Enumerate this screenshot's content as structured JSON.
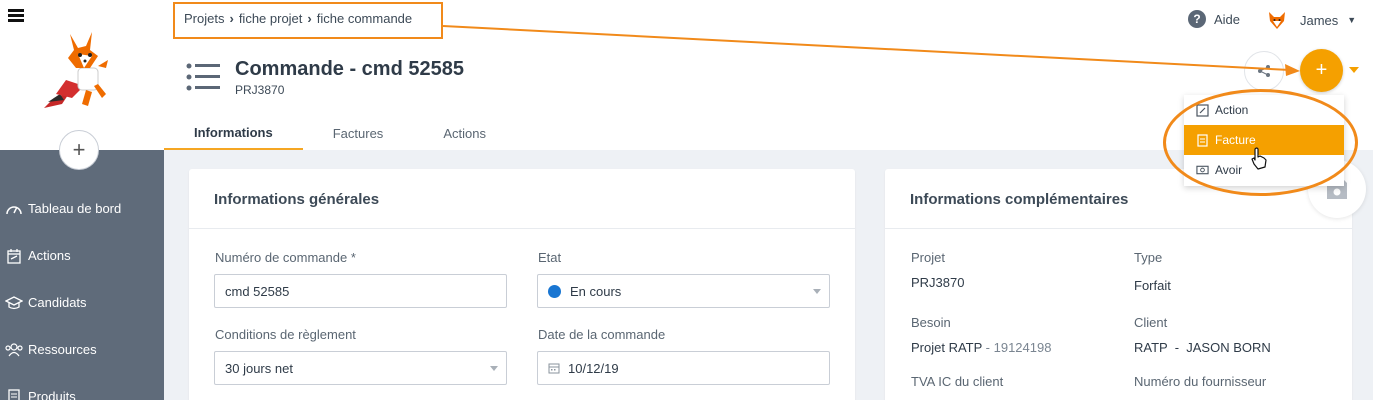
{
  "breadcrumb": {
    "items": [
      "Projets",
      "fiche projet",
      "fiche commande"
    ]
  },
  "header": {
    "help_label": "Aide",
    "user_name": "James",
    "title": "Commande - cmd 52585",
    "subtitle": "PRJ3870"
  },
  "tabs": [
    {
      "label": "Informations"
    },
    {
      "label": "Factures"
    },
    {
      "label": "Actions"
    }
  ],
  "sidebar": {
    "add_label": "+",
    "items": [
      {
        "label": "Tableau de bord",
        "icon": "dashboard-icon"
      },
      {
        "label": "Actions",
        "icon": "calendar-icon"
      },
      {
        "label": "Candidats",
        "icon": "graduation-cap-icon"
      },
      {
        "label": "Ressources",
        "icon": "users-icon"
      },
      {
        "label": "Produits",
        "icon": "document-icon"
      }
    ]
  },
  "actions": {
    "plus_label": "+",
    "menu": [
      {
        "label": "Action",
        "icon": "edit-icon"
      },
      {
        "label": "Facture",
        "icon": "invoice-icon"
      },
      {
        "label": "Avoir",
        "icon": "money-icon"
      }
    ]
  },
  "general": {
    "title": "Informations générales",
    "order_number_label": "Numéro de commande *",
    "order_number_value": "cmd 52585",
    "state_label": "Etat",
    "state_value": "En cours",
    "payment_label": "Conditions de règlement",
    "payment_value": "30 jours net",
    "date_label": "Date de la commande",
    "date_value": "10/12/19"
  },
  "complementary": {
    "title": "Informations complémentaires",
    "project_label": "Projet",
    "project_value": "PRJ3870",
    "type_label": "Type",
    "type_value": "Forfait",
    "need_label": "Besoin",
    "need_value": "Projet RATP",
    "need_ref": "- 19124198",
    "client_label": "Client",
    "client_value": "RATP  -  JASON BORN",
    "vat_label": "TVA IC du client",
    "supplier_label": "Numéro du fournisseur"
  },
  "colors": {
    "accent": "#f5a000",
    "highlight": "#f18a1a",
    "sidebar": "#5f6b7a",
    "state_dot": "#1976d2"
  }
}
